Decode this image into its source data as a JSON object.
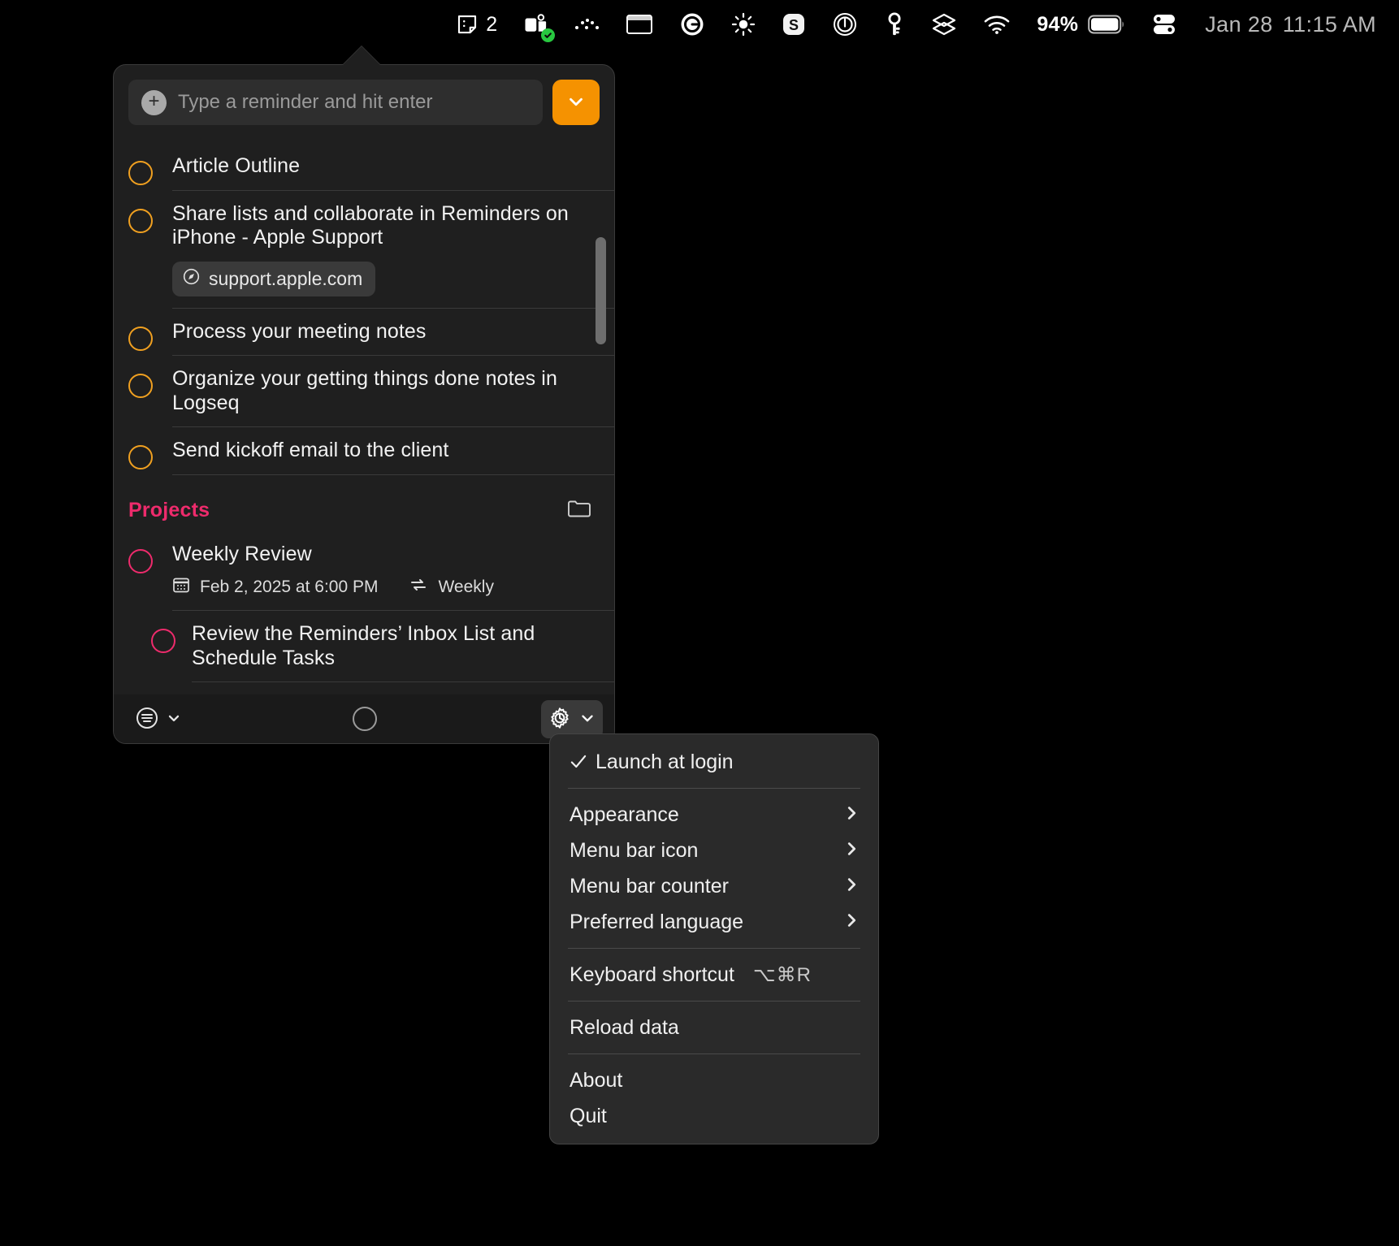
{
  "menubar": {
    "items": [
      {
        "name": "sticky-notes-icon",
        "count": "2"
      },
      {
        "name": "microsoft-teams-icon",
        "badge": "available-check"
      },
      {
        "name": "dots-pattern-icon"
      },
      {
        "name": "window-manager-icon"
      },
      {
        "name": "grammarly-icon"
      },
      {
        "name": "brightness-icon"
      },
      {
        "name": "setapp-icon"
      },
      {
        "name": "one-password-icon"
      },
      {
        "name": "key-icon"
      },
      {
        "name": "layers-icon"
      },
      {
        "name": "wifi-icon"
      }
    ],
    "battery_percent": "94%",
    "control_center": "control-center-icon",
    "date": "Jan 28",
    "time": "11:15 AM"
  },
  "popover": {
    "add_field": {
      "placeholder": "Type a reminder and hit enter",
      "value": "",
      "add_icon": "plus-circle-icon"
    },
    "dropdown_button": {
      "icon": "chevron-down-icon",
      "color": "#f59201"
    },
    "reminders": [
      {
        "title": "Article Outline",
        "color": "#f0a020",
        "url": null,
        "meta": null
      },
      {
        "title": "Share lists and collaborate in Reminders on iPhone - Apple Support",
        "color": "#f0a020",
        "url": "support.apple.com",
        "url_icon": "safari-compass-icon",
        "meta": null
      },
      {
        "title": "Process your meeting notes",
        "color": "#f0a020",
        "url": null,
        "meta": null
      },
      {
        "title": "Organize your getting things done notes in Logseq",
        "color": "#f0a020",
        "url": null,
        "meta": null
      },
      {
        "title": "Send kickoff email to the client",
        "color": "#f0a020",
        "url": null,
        "meta": null
      }
    ],
    "group": {
      "title": "Projects",
      "color": "#ee2b6c",
      "folder_icon": "folder-icon",
      "items": [
        {
          "title": "Weekly Review",
          "color": "#ee2b6c",
          "date": "Feb 2, 2025 at 6:00 PM",
          "date_icon": "calendar-icon",
          "repeat": "Weekly",
          "repeat_icon": "repeat-icon",
          "sub": false
        },
        {
          "title": "Review the Reminders’ Inbox List and Schedule Tasks",
          "color": "#ee2b6c",
          "sub": true
        }
      ]
    },
    "footer": {
      "list_filter": {
        "icon": "list-filter-icon",
        "chevron": "chevron-down-icon"
      },
      "center": {
        "icon": "empty-circle-icon"
      },
      "settings": {
        "icon": "gear-icon",
        "chevron": "chevron-down-icon"
      }
    }
  },
  "context_menu": {
    "items": [
      {
        "label": "Launch at login",
        "checked": true,
        "type": "check"
      },
      {
        "type": "separator"
      },
      {
        "label": "Appearance",
        "type": "submenu",
        "arrow": "chevron-right-icon"
      },
      {
        "label": "Menu bar icon",
        "type": "submenu",
        "arrow": "chevron-right-icon"
      },
      {
        "label": "Menu bar counter",
        "type": "submenu",
        "arrow": "chevron-right-icon"
      },
      {
        "label": "Preferred language",
        "type": "submenu",
        "arrow": "chevron-right-icon"
      },
      {
        "type": "separator"
      },
      {
        "label": "Keyboard shortcut",
        "type": "shortcut",
        "shortcut": "⌥⌘R"
      },
      {
        "type": "separator"
      },
      {
        "label": "Reload data",
        "type": "plain"
      },
      {
        "type": "separator"
      },
      {
        "label": "About",
        "type": "plain"
      },
      {
        "label": "Quit",
        "type": "plain"
      }
    ]
  }
}
